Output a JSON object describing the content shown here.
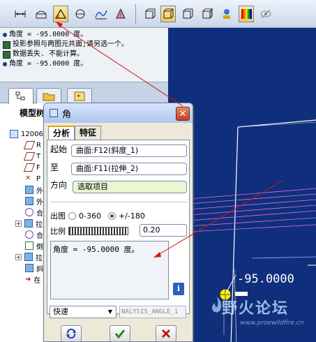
{
  "messages": [
    {
      "icon": "bullet",
      "text": "角度 = -95.0000 度。"
    },
    {
      "icon": "warning",
      "text": "投影参照与两图元共面;请另选一个。"
    },
    {
      "icon": "warning",
      "text": "数据丢失. 不能计算。"
    },
    {
      "icon": "bullet",
      "text": "角度 = -95.0000 度。"
    }
  ],
  "tree": {
    "title": "模型树",
    "items": [
      "12006",
      "R",
      "T",
      "F",
      "P",
      "外",
      "外",
      "合",
      "拉",
      "合",
      "倒",
      "拉",
      "斜",
      "在"
    ]
  },
  "dialog": {
    "title": "角",
    "tabs": [
      "分析",
      "特征"
    ],
    "from_label": "起始",
    "from_value": "曲面:F12(斜度_1)",
    "to_label": "至",
    "to_value": "曲面:F11(拉伸_2)",
    "dir_label": "方向",
    "dir_value": "选取项目",
    "output_label": "出图",
    "opt1": "0-360",
    "opt2": "+/-180",
    "scale_label": "比例",
    "scale_value": "0.20",
    "result": "角度 = -95.0000 度。",
    "mode": "快速",
    "name": "NALYSIS_ANGLE_1"
  },
  "graphics": {
    "dimension": "-95.0000",
    "bg_color": "#0f2e7b"
  },
  "watermark": {
    "text": "野火论坛",
    "url": "www.proewildfire.cn"
  }
}
